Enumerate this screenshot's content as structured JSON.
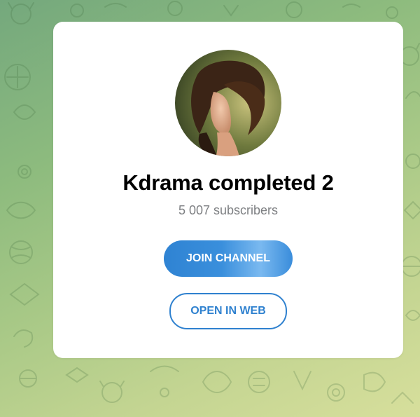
{
  "background": {
    "gradient_colors": [
      "#74a87d",
      "#a9c987",
      "#d7df9c"
    ]
  },
  "channel": {
    "title": "Kdrama completed 2",
    "subscribers": "5 007 subscribers",
    "avatar": "channel-avatar-photo"
  },
  "actions": {
    "join_label": "JOIN CHANNEL",
    "web_label": "OPEN IN WEB"
  },
  "colors": {
    "accent": "#2f81cf",
    "title": "#000000",
    "muted": "#7d7f82"
  }
}
